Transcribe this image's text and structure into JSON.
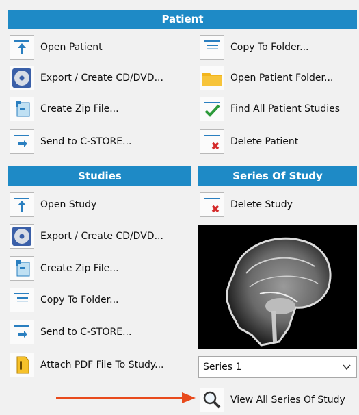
{
  "patient": {
    "header": "Patient",
    "left": [
      {
        "label": "Open Patient",
        "icon": "open-arrow-icon"
      },
      {
        "label": "Export / Create CD/DVD...",
        "icon": "cd-icon"
      },
      {
        "label": "Create Zip File...",
        "icon": "zip-icon"
      },
      {
        "label": "Send to C-STORE...",
        "icon": "send-icon"
      }
    ],
    "right": [
      {
        "label": "Copy To Folder...",
        "icon": "copy-icon"
      },
      {
        "label": "Open Patient Folder...",
        "icon": "folder-icon"
      },
      {
        "label": "Find All Patient Studies",
        "icon": "checkmark-icon"
      },
      {
        "label": "Delete Patient",
        "icon": "delete-icon"
      }
    ]
  },
  "studies": {
    "header": "Studies",
    "items": [
      {
        "label": "Open Study",
        "icon": "open-arrow-icon"
      },
      {
        "label": "Export / Create CD/DVD...",
        "icon": "cd-icon"
      },
      {
        "label": "Create Zip File...",
        "icon": "zip-icon"
      },
      {
        "label": "Copy To Folder...",
        "icon": "copy-icon"
      },
      {
        "label": "Send to C-STORE...",
        "icon": "send-icon"
      },
      {
        "label": "Attach PDF File To Study...",
        "icon": "attach-pdf-icon"
      }
    ]
  },
  "series": {
    "header": "Series Of Study",
    "delete_label": "Delete Study",
    "selected": "Series 1",
    "view_all_label": "View All Series Of Study"
  },
  "colors": {
    "header": "#1e8ac6",
    "arrow": "#e84a1c"
  }
}
